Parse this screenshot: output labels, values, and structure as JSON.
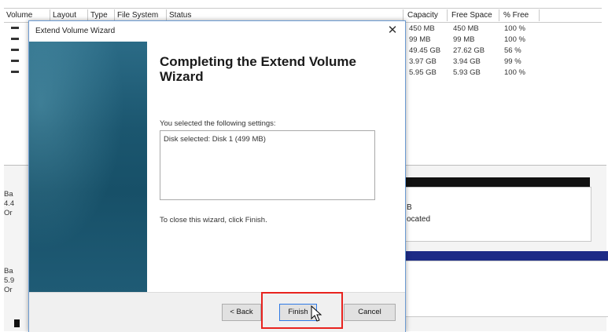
{
  "disk_manager": {
    "columns": [
      "Volume",
      "Layout",
      "Type",
      "File System",
      "Status",
      "Capacity",
      "Free Space",
      "% Free"
    ],
    "volumes": [
      {
        "capacity": "450 MB",
        "free": "450 MB",
        "pct": "100 %"
      },
      {
        "capacity": "99 MB",
        "free": "99 MB",
        "pct": "100 %"
      },
      {
        "capacity": "49.45 GB",
        "free": "27.62 GB",
        "pct": "56 %"
      },
      {
        "capacity": "3.97 GB",
        "free": "3.94 GB",
        "pct": "99 %"
      },
      {
        "capacity": "5.95 GB",
        "free": "5.93 GB",
        "pct": "100 %"
      }
    ],
    "disk_rows": [
      {
        "lines": [
          "Ba",
          "4.4",
          "Or"
        ]
      },
      {
        "lines": [
          "Ba",
          "5.9",
          "Or"
        ]
      }
    ],
    "partition_fragments": [
      "B",
      "ocated"
    ]
  },
  "wizard": {
    "title": "Extend Volume Wizard",
    "close_glyph": "✕",
    "heading_line1": "Completing the Extend Volume",
    "heading_line2": "Wizard",
    "selected_intro": "You selected the following settings:",
    "settings_text": "Disk selected: Disk 1 (499 MB)",
    "close_note": "To close this wizard, click Finish.",
    "buttons": {
      "back": "< Back",
      "finish": "Finish",
      "cancel": "Cancel"
    }
  },
  "colors": {
    "highlight": "#e8231f",
    "side_panel": "#1b566f",
    "disk_blue": "#1d2b86"
  }
}
